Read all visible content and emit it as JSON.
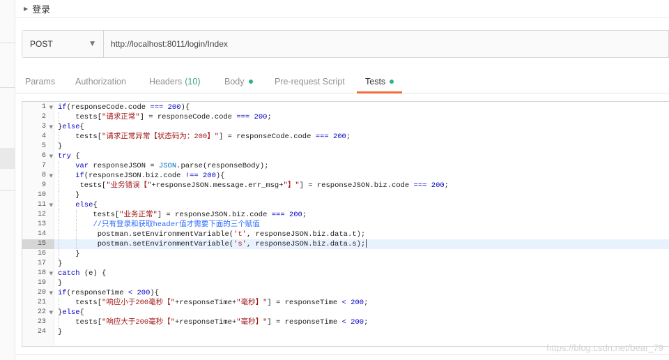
{
  "request": {
    "title": "登录",
    "method": "POST",
    "url": "http://localhost:8011/login/Index"
  },
  "tabs": [
    {
      "label": "Params",
      "count": "",
      "dot": false,
      "active": false
    },
    {
      "label": "Authorization",
      "count": "",
      "dot": false,
      "active": false
    },
    {
      "label": "Headers",
      "count": "(10)",
      "dot": false,
      "active": false
    },
    {
      "label": "Body",
      "count": "",
      "dot": true,
      "active": false
    },
    {
      "label": "Pre-request Script",
      "count": "",
      "dot": false,
      "active": false
    },
    {
      "label": "Tests",
      "count": "",
      "dot": true,
      "active": true
    }
  ],
  "editor": {
    "highlighted_line": 15,
    "lines": [
      {
        "n": "1",
        "fold": true,
        "indent": 0,
        "text": "if(responseCode.code === 200){"
      },
      {
        "n": "2",
        "fold": false,
        "indent": 1,
        "text": "tests[\"请求正常\"] = responseCode.code === 200;"
      },
      {
        "n": "3",
        "fold": true,
        "indent": 0,
        "text": "}else{"
      },
      {
        "n": "4",
        "fold": false,
        "indent": 1,
        "text": "tests[\"请求正常异常【状态码为：200】\"] = responseCode.code === 200;"
      },
      {
        "n": "5",
        "fold": false,
        "indent": 0,
        "text": "}"
      },
      {
        "n": "6",
        "fold": true,
        "indent": 0,
        "text": "try {"
      },
      {
        "n": "7",
        "fold": false,
        "indent": 1,
        "text": "var responseJSON = JSON.parse(responseBody);"
      },
      {
        "n": "8",
        "fold": true,
        "indent": 1,
        "text": "if(responseJSON.biz.code !== 200){"
      },
      {
        "n": "9",
        "fold": false,
        "indent": 1,
        "text": " tests[\"业务错误【\"+responseJSON.message.err_msg+\"】\"] = responseJSON.biz.code === 200;"
      },
      {
        "n": "10",
        "fold": false,
        "indent": 1,
        "text": "}"
      },
      {
        "n": "11",
        "fold": true,
        "indent": 1,
        "text": "else{"
      },
      {
        "n": "12",
        "fold": false,
        "indent": 2,
        "text": "tests[\"业务正常\"] = responseJSON.biz.code === 200;"
      },
      {
        "n": "13",
        "fold": false,
        "indent": 2,
        "text": "//只有登录和获取header值才需要下面的三个赋值",
        "comment": true
      },
      {
        "n": "14",
        "fold": false,
        "indent": 2,
        "text": " postman.setEnvironmentVariable('t', responseJSON.biz.data.t);"
      },
      {
        "n": "15",
        "fold": false,
        "indent": 2,
        "text": " postman.setEnvironmentVariable('s', responseJSON.biz.data.s);"
      },
      {
        "n": "16",
        "fold": false,
        "indent": 1,
        "text": "}"
      },
      {
        "n": "17",
        "fold": false,
        "indent": 0,
        "text": "}"
      },
      {
        "n": "18",
        "fold": true,
        "indent": 0,
        "text": "catch (e) {"
      },
      {
        "n": "19",
        "fold": false,
        "indent": 0,
        "text": "}"
      },
      {
        "n": "20",
        "fold": true,
        "indent": 0,
        "text": "if(responseTime < 200){"
      },
      {
        "n": "21",
        "fold": false,
        "indent": 1,
        "text": "tests[\"响应小于200毫秒【\"+responseTime+\"毫秒】\"] = responseTime < 200;"
      },
      {
        "n": "22",
        "fold": true,
        "indent": 0,
        "text": "}else{"
      },
      {
        "n": "23",
        "fold": false,
        "indent": 1,
        "text": "tests[\"响应大于200毫秒【\"+responseTime+\"毫秒】\"] = responseTime < 200;"
      },
      {
        "n": "24",
        "fold": false,
        "indent": 0,
        "text": "}"
      }
    ]
  },
  "watermark": "https://blog.csdn.net/bear_79",
  "icons": {
    "collapse": "caret-right-icon",
    "method_dropdown": "chevron-down-icon",
    "fold": "fold-down-icon"
  }
}
